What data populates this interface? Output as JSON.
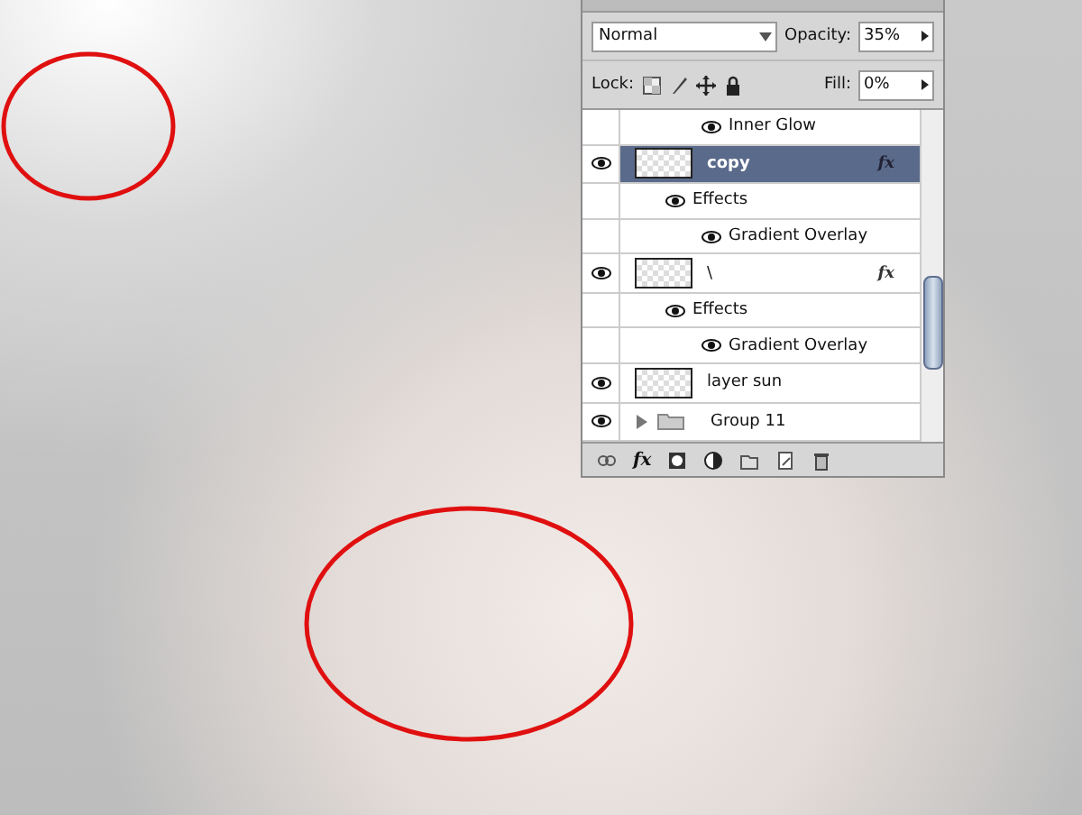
{
  "panel": {
    "blend_mode": "Normal",
    "opacity": {
      "label": "Opacity:",
      "value": "35%"
    },
    "lock": {
      "label": "Lock:"
    },
    "fill": {
      "label": "Fill:",
      "value": "0%"
    },
    "layers": [
      {
        "kind": "effect",
        "name": "Inner Glow",
        "visible": true,
        "selected": false
      },
      {
        "kind": "layer",
        "name": "copy",
        "visible": true,
        "selected": true,
        "fx": "fx"
      },
      {
        "kind": "effects",
        "name": "Effects",
        "visible": true,
        "selected": false
      },
      {
        "kind": "effect",
        "name": "Gradient Overlay",
        "visible": true,
        "selected": false
      },
      {
        "kind": "layer",
        "name": "\\",
        "visible": true,
        "selected": false,
        "fx": "fx"
      },
      {
        "kind": "effects",
        "name": "Effects",
        "visible": true,
        "selected": false
      },
      {
        "kind": "effect",
        "name": "Gradient Overlay",
        "visible": true,
        "selected": false
      },
      {
        "kind": "layer",
        "name": "layer sun",
        "visible": true,
        "selected": false
      },
      {
        "kind": "group",
        "name": "Group 11",
        "visible": true,
        "selected": false,
        "expanded": false
      }
    ],
    "footer": {
      "fx": "fx"
    }
  }
}
